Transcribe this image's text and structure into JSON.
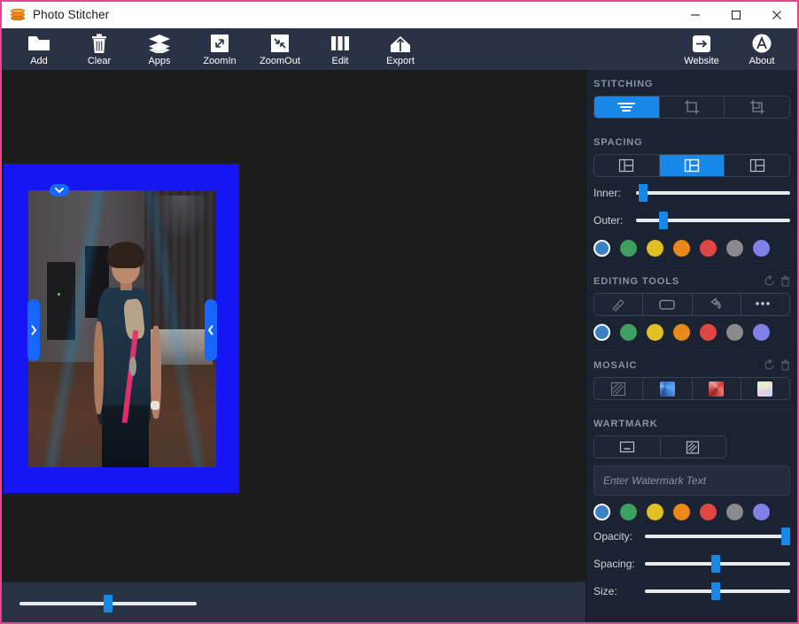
{
  "window": {
    "title": "Photo Stitcher",
    "app_icon": "layers-stack-icon",
    "minimize_label": "Minimize",
    "maximize_label": "Maximize",
    "close_label": "Close",
    "border_color": "#e8458f"
  },
  "toolbar": {
    "items": [
      {
        "label": "Add",
        "icon": "folder-icon"
      },
      {
        "label": "Clear",
        "icon": "trash-icon"
      },
      {
        "label": "Apps",
        "icon": "layers-icon"
      },
      {
        "label": "ZoomIn",
        "icon": "zoom-in-icon"
      },
      {
        "label": "ZoomOut",
        "icon": "zoom-out-icon"
      },
      {
        "label": "Edit",
        "icon": "columns-icon"
      },
      {
        "label": "Export",
        "icon": "upload-icon"
      }
    ],
    "right_items": [
      {
        "label": "Website",
        "icon": "arrow-right-box-icon"
      },
      {
        "label": "About",
        "icon": "letter-a-circle-icon"
      }
    ]
  },
  "canvas": {
    "sheet_color": "#1616f5",
    "background_color": "#1c1c1c",
    "handles": [
      {
        "name": "left-resize-handle",
        "icon": "chevron-right-icon"
      },
      {
        "name": "right-resize-handle",
        "icon": "chevron-left-icon"
      },
      {
        "name": "top-resize-handle",
        "icon": "chevron-down-icon"
      }
    ],
    "zoom_slider": {
      "name": "canvas-zoom-slider",
      "value": 50
    }
  },
  "panel": {
    "stitching": {
      "title": "STITCHING",
      "options": [
        {
          "name": "stitch-mode-lines",
          "icon": "horizontal-lines-icon",
          "active": true
        },
        {
          "name": "stitch-mode-crop",
          "icon": "crop-icon",
          "active": false
        },
        {
          "name": "stitch-mode-crop-alt",
          "icon": "crop-alt-icon",
          "active": false
        }
      ]
    },
    "spacing": {
      "title": "SPACING",
      "options": [
        {
          "name": "spacing-layout-1",
          "icon": "layout-left-icon",
          "active": false
        },
        {
          "name": "spacing-layout-2",
          "icon": "layout-center-icon",
          "active": true
        },
        {
          "name": "spacing-layout-3",
          "icon": "layout-right-icon",
          "active": false
        }
      ],
      "inner_label": "Inner:",
      "inner_value": 2,
      "outer_label": "Outer:",
      "outer_value": 17,
      "colors": [
        {
          "hex": "#3b7fc4",
          "selected": true
        },
        {
          "hex": "#3da05e",
          "selected": false
        },
        {
          "hex": "#e0c022",
          "selected": false
        },
        {
          "hex": "#e8891a",
          "selected": false
        },
        {
          "hex": "#e04646",
          "selected": false
        },
        {
          "hex": "#8a8a8a",
          "selected": false
        },
        {
          "hex": "#8080e8",
          "selected": false
        }
      ]
    },
    "editing_tools": {
      "title": "EDITING TOOLS",
      "reset_icon": "reset-circle-icon",
      "delete_icon": "trash-icon",
      "options": [
        {
          "name": "tool-brush",
          "icon": "brush-icon"
        },
        {
          "name": "tool-shape",
          "icon": "rounded-rect-icon"
        },
        {
          "name": "tool-undo",
          "icon": "undo-arrow-icon"
        },
        {
          "name": "tool-more",
          "icon": "ellipsis-dropdown-icon"
        }
      ],
      "colors": [
        {
          "hex": "#3b7fc4",
          "selected": true
        },
        {
          "hex": "#3da05e",
          "selected": false
        },
        {
          "hex": "#e0c022",
          "selected": false
        },
        {
          "hex": "#e8891a",
          "selected": false
        },
        {
          "hex": "#e04646",
          "selected": false
        },
        {
          "hex": "#8a8a8a",
          "selected": false
        },
        {
          "hex": "#8080e8",
          "selected": false
        }
      ]
    },
    "mosaic": {
      "title": "MOSAIC",
      "reset_icon": "reset-circle-icon",
      "delete_icon": "trash-icon",
      "options": [
        {
          "name": "mosaic-none",
          "icon": "diagonal-hatch-icon",
          "swatch": "none"
        },
        {
          "name": "mosaic-blue",
          "icon": "mosaic-swatch-icon",
          "swatch": "blue"
        },
        {
          "name": "mosaic-red",
          "icon": "mosaic-swatch-icon",
          "swatch": "red"
        },
        {
          "name": "mosaic-pastel",
          "icon": "mosaic-swatch-icon",
          "swatch": "pastel"
        }
      ]
    },
    "watermark": {
      "title": "WARTMARK",
      "options": [
        {
          "name": "watermark-text-mode",
          "icon": "text-box-icon"
        },
        {
          "name": "watermark-pattern-mode",
          "icon": "diagonal-hatch-box-icon"
        }
      ],
      "input_placeholder": "Enter Watermark Text",
      "input_value": "",
      "colors": [
        {
          "hex": "#3b7fc4",
          "selected": true
        },
        {
          "hex": "#3da05e",
          "selected": false
        },
        {
          "hex": "#e0c022",
          "selected": false
        },
        {
          "hex": "#e8891a",
          "selected": false
        },
        {
          "hex": "#e04646",
          "selected": false
        },
        {
          "hex": "#8a8a8a",
          "selected": false
        },
        {
          "hex": "#8080e8",
          "selected": false
        }
      ],
      "sliders": [
        {
          "name": "watermark-opacity-slider",
          "label": "Opacity:",
          "value": 97
        },
        {
          "name": "watermark-spacing-slider",
          "label": "Spacing:",
          "value": 49
        },
        {
          "name": "watermark-size-slider",
          "label": "Size:",
          "value": 49
        }
      ]
    }
  }
}
